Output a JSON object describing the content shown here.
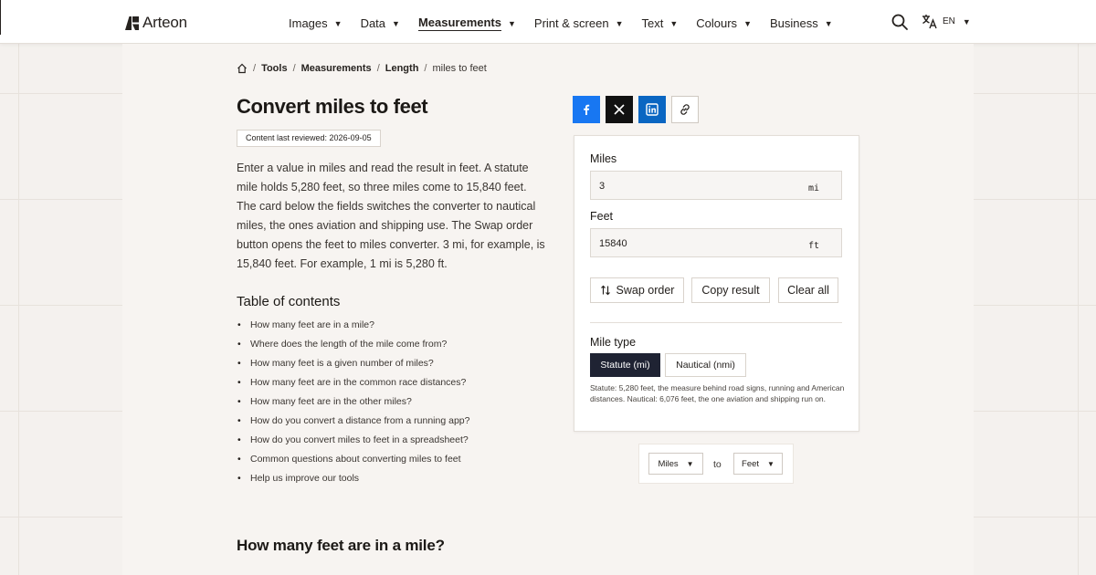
{
  "brand": {
    "name": "Arteon"
  },
  "nav": [
    {
      "label": "Images",
      "active": false
    },
    {
      "label": "Data",
      "active": false
    },
    {
      "label": "Measurements",
      "active": true
    },
    {
      "label": "Print & screen",
      "active": false
    },
    {
      "label": "Text",
      "active": false
    },
    {
      "label": "Colours",
      "active": false
    },
    {
      "label": "Business",
      "active": false
    }
  ],
  "header": {
    "search_icon": "search-icon",
    "language": "EN",
    "language_icon": "translate-icon"
  },
  "breadcrumb": {
    "home_icon": "home-icon",
    "items": [
      "Tools",
      "Measurements",
      "Length"
    ],
    "current": "miles to feet"
  },
  "page": {
    "title": "Convert miles to feet",
    "reviewed": "Content last reviewed: 2026-09-05",
    "intro": "Enter a value in miles and read the result in feet. A statute mile holds 5,280 feet, so three miles come to 15,840 feet. The card below the fields switches the converter to nautical miles, the ones aviation and shipping use. The Swap order button opens the feet to miles converter. 3 mi, for example, is 15,840 feet. For example, 1 mi is 5,280 ft.",
    "toc_title": "Table of contents",
    "toc": [
      "How many feet are in a mile?",
      "Where does the length of the mile come from?",
      "How many feet is a given number of miles?",
      "How many feet are in the common race distances?",
      "How many feet are in the other miles?",
      "How do you convert a distance from a running app?",
      "How do you convert miles to feet in a spreadsheet?",
      "Common questions about converting miles to feet",
      "Help us improve our tools"
    ],
    "section_heading": "How many feet are in a mile?"
  },
  "share": {
    "icons": [
      "facebook-icon",
      "x-icon",
      "linkedin-icon",
      "link-icon"
    ]
  },
  "converter": {
    "miles_label": "Miles",
    "miles_value": "3",
    "miles_unit": "mi",
    "feet_label": "Feet",
    "feet_value": "15840",
    "feet_unit": "ft",
    "swap_label": "Swap order",
    "copy_label": "Copy result",
    "clear_label": "Clear all",
    "mile_type_label": "Mile type",
    "statute_label": "Statute (mi)",
    "nautical_label": "Nautical (nmi)",
    "note": "Statute: 5,280 feet, the measure behind road signs, running and American distances. Nautical: 6,076 feet, the one aviation and shipping run on."
  },
  "unit_picker": {
    "from": "Miles",
    "to_word": "to",
    "to": "Feet"
  },
  "colors": {
    "facebook": "#1877f2",
    "x": "#111111",
    "linkedin": "#0a66c2",
    "active_segment": "#1f2333"
  }
}
